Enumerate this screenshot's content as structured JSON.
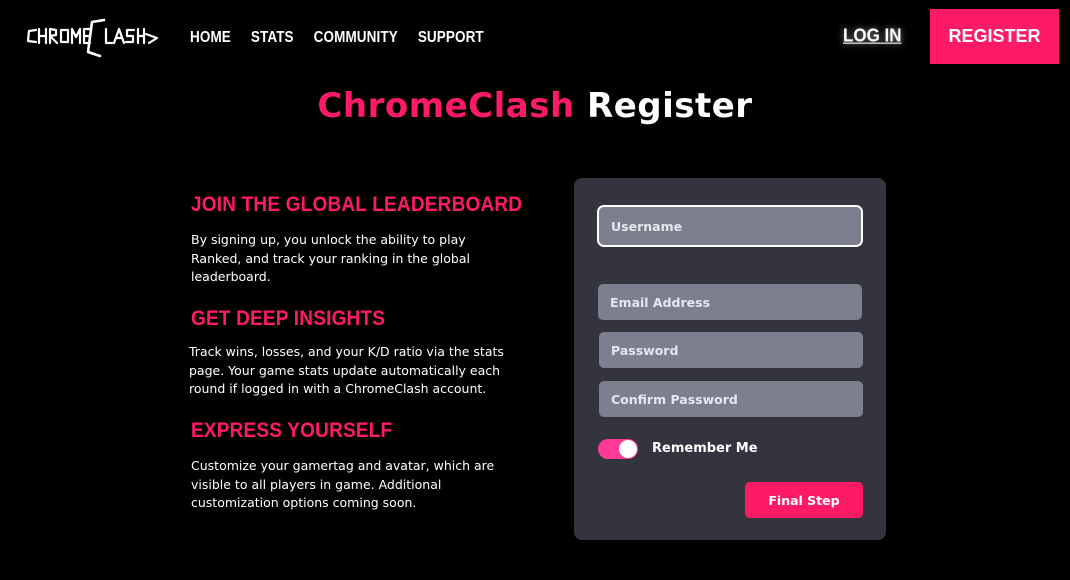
{
  "header": {
    "logo_text": "CHROMECLASH",
    "nav": [
      "HOME",
      "STATS",
      "COMMUNITY",
      "SUPPORT"
    ],
    "login_label": "LOG IN",
    "register_label": "REGISTER"
  },
  "page": {
    "title_brand": "ChromeClash",
    "title_rest": "Register"
  },
  "features": [
    {
      "heading": "JOIN THE GLOBAL LEADERBOARD",
      "lines": [
        "By signing up, you unlock the ability to play",
        "Ranked, and track your ranking in the global",
        "leaderboard."
      ]
    },
    {
      "heading": "GET DEEP INSIGHTS",
      "lines": [
        "Track wins, losses, and your K/D ratio via the stats",
        "page. Your game  stats update automatically each",
        "round if logged in with a ChromeClash account."
      ]
    },
    {
      "heading": "EXPRESS YOURSELF",
      "lines": [
        "Customize your gamertag and avatar, which are",
        "visible to all players in game. Additional",
        "customization options coming soon."
      ]
    }
  ],
  "form": {
    "username_placeholder": "Username",
    "email_placeholder": "Email Address",
    "password_placeholder": "Password",
    "confirm_placeholder": "Confirm Password",
    "remember_label": "Remember Me",
    "remember_on": true,
    "submit_label": "Final Step"
  },
  "colors": {
    "accent": "#ff1a66",
    "panel": "#34343f",
    "field": "#7d7f8e",
    "background": "#000000"
  }
}
